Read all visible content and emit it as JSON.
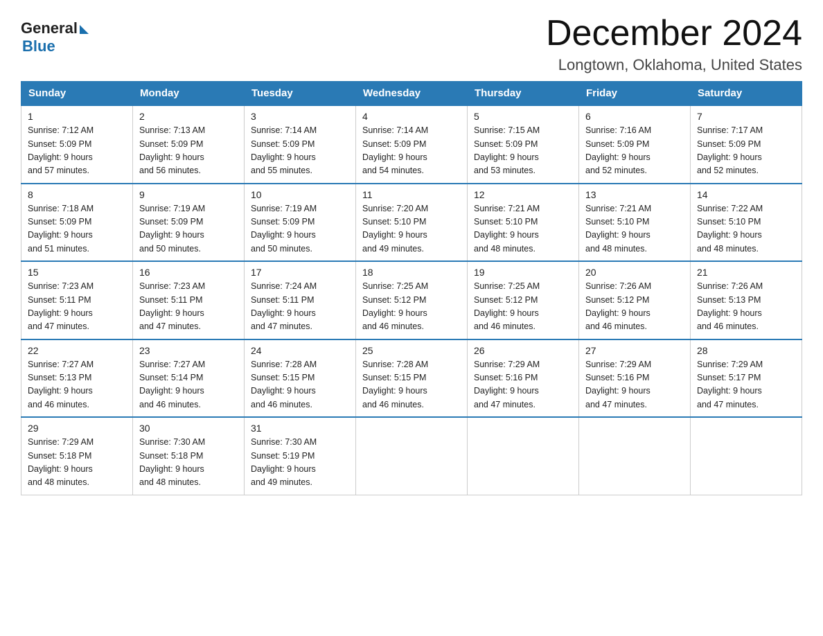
{
  "logo": {
    "general": "General",
    "triangle": "",
    "blue": "Blue"
  },
  "title": "December 2024",
  "subtitle": "Longtown, Oklahoma, United States",
  "days_of_week": [
    "Sunday",
    "Monday",
    "Tuesday",
    "Wednesday",
    "Thursday",
    "Friday",
    "Saturday"
  ],
  "weeks": [
    [
      {
        "day": "1",
        "sunrise": "7:12 AM",
        "sunset": "5:09 PM",
        "daylight": "9 hours and 57 minutes."
      },
      {
        "day": "2",
        "sunrise": "7:13 AM",
        "sunset": "5:09 PM",
        "daylight": "9 hours and 56 minutes."
      },
      {
        "day": "3",
        "sunrise": "7:14 AM",
        "sunset": "5:09 PM",
        "daylight": "9 hours and 55 minutes."
      },
      {
        "day": "4",
        "sunrise": "7:14 AM",
        "sunset": "5:09 PM",
        "daylight": "9 hours and 54 minutes."
      },
      {
        "day": "5",
        "sunrise": "7:15 AM",
        "sunset": "5:09 PM",
        "daylight": "9 hours and 53 minutes."
      },
      {
        "day": "6",
        "sunrise": "7:16 AM",
        "sunset": "5:09 PM",
        "daylight": "9 hours and 52 minutes."
      },
      {
        "day": "7",
        "sunrise": "7:17 AM",
        "sunset": "5:09 PM",
        "daylight": "9 hours and 52 minutes."
      }
    ],
    [
      {
        "day": "8",
        "sunrise": "7:18 AM",
        "sunset": "5:09 PM",
        "daylight": "9 hours and 51 minutes."
      },
      {
        "day": "9",
        "sunrise": "7:19 AM",
        "sunset": "5:09 PM",
        "daylight": "9 hours and 50 minutes."
      },
      {
        "day": "10",
        "sunrise": "7:19 AM",
        "sunset": "5:09 PM",
        "daylight": "9 hours and 50 minutes."
      },
      {
        "day": "11",
        "sunrise": "7:20 AM",
        "sunset": "5:10 PM",
        "daylight": "9 hours and 49 minutes."
      },
      {
        "day": "12",
        "sunrise": "7:21 AM",
        "sunset": "5:10 PM",
        "daylight": "9 hours and 48 minutes."
      },
      {
        "day": "13",
        "sunrise": "7:21 AM",
        "sunset": "5:10 PM",
        "daylight": "9 hours and 48 minutes."
      },
      {
        "day": "14",
        "sunrise": "7:22 AM",
        "sunset": "5:10 PM",
        "daylight": "9 hours and 48 minutes."
      }
    ],
    [
      {
        "day": "15",
        "sunrise": "7:23 AM",
        "sunset": "5:11 PM",
        "daylight": "9 hours and 47 minutes."
      },
      {
        "day": "16",
        "sunrise": "7:23 AM",
        "sunset": "5:11 PM",
        "daylight": "9 hours and 47 minutes."
      },
      {
        "day": "17",
        "sunrise": "7:24 AM",
        "sunset": "5:11 PM",
        "daylight": "9 hours and 47 minutes."
      },
      {
        "day": "18",
        "sunrise": "7:25 AM",
        "sunset": "5:12 PM",
        "daylight": "9 hours and 46 minutes."
      },
      {
        "day": "19",
        "sunrise": "7:25 AM",
        "sunset": "5:12 PM",
        "daylight": "9 hours and 46 minutes."
      },
      {
        "day": "20",
        "sunrise": "7:26 AM",
        "sunset": "5:12 PM",
        "daylight": "9 hours and 46 minutes."
      },
      {
        "day": "21",
        "sunrise": "7:26 AM",
        "sunset": "5:13 PM",
        "daylight": "9 hours and 46 minutes."
      }
    ],
    [
      {
        "day": "22",
        "sunrise": "7:27 AM",
        "sunset": "5:13 PM",
        "daylight": "9 hours and 46 minutes."
      },
      {
        "day": "23",
        "sunrise": "7:27 AM",
        "sunset": "5:14 PM",
        "daylight": "9 hours and 46 minutes."
      },
      {
        "day": "24",
        "sunrise": "7:28 AM",
        "sunset": "5:15 PM",
        "daylight": "9 hours and 46 minutes."
      },
      {
        "day": "25",
        "sunrise": "7:28 AM",
        "sunset": "5:15 PM",
        "daylight": "9 hours and 46 minutes."
      },
      {
        "day": "26",
        "sunrise": "7:29 AM",
        "sunset": "5:16 PM",
        "daylight": "9 hours and 47 minutes."
      },
      {
        "day": "27",
        "sunrise": "7:29 AM",
        "sunset": "5:16 PM",
        "daylight": "9 hours and 47 minutes."
      },
      {
        "day": "28",
        "sunrise": "7:29 AM",
        "sunset": "5:17 PM",
        "daylight": "9 hours and 47 minutes."
      }
    ],
    [
      {
        "day": "29",
        "sunrise": "7:29 AM",
        "sunset": "5:18 PM",
        "daylight": "9 hours and 48 minutes."
      },
      {
        "day": "30",
        "sunrise": "7:30 AM",
        "sunset": "5:18 PM",
        "daylight": "9 hours and 48 minutes."
      },
      {
        "day": "31",
        "sunrise": "7:30 AM",
        "sunset": "5:19 PM",
        "daylight": "9 hours and 49 minutes."
      },
      null,
      null,
      null,
      null
    ]
  ],
  "labels": {
    "sunrise": "Sunrise:",
    "sunset": "Sunset:",
    "daylight": "Daylight:"
  }
}
